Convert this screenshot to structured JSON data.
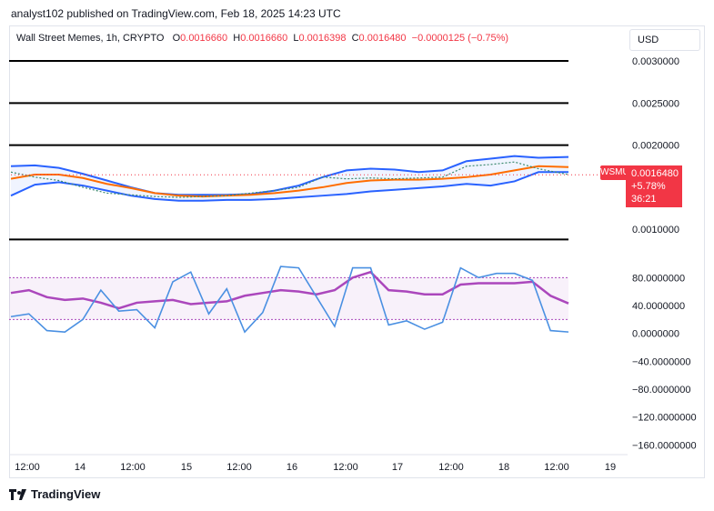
{
  "header": {
    "publish_line": "analyst102 published on TradingView.com, Feb 18, 2025 14:23 UTC"
  },
  "legend": {
    "symbol": "Wall Street Memes, 1h, CRYPTO",
    "o_label": "O",
    "o_value": "0.0016660",
    "h_label": "H",
    "h_value": "0.0016660",
    "l_label": "L",
    "l_value": "0.0016398",
    "c_label": "C",
    "c_value": "0.0016480",
    "change": "−0.0000125 (−0.75%)"
  },
  "currency_button": "USD",
  "price_tag": {
    "ticker": "WSMUSD",
    "price": "0.0016480",
    "change": "+5.78%",
    "countdown": "36:21"
  },
  "brand": {
    "name": "TradingView"
  },
  "colors": {
    "accent_red": "#f23645",
    "bb_band": "#2962ff",
    "bb_basis": "#ff6d00",
    "rsi": "#ab47bc",
    "stoch": "#4a90e2"
  },
  "chart_data": [
    {
      "type": "line",
      "title": "Wall Street Memes, 1h, CRYPTO",
      "y_ticks": [
        "0.0030000",
        "0.0025000",
        "0.0020000",
        "0.0010000"
      ],
      "ylim": [
        0.0007,
        0.0034
      ],
      "x_ticks": [
        "12:00",
        "14",
        "12:00",
        "15",
        "12:00",
        "16",
        "12:00",
        "17",
        "12:00",
        "18",
        "12:00",
        "19"
      ],
      "horizontal_levels": [
        0.003,
        0.0025,
        0.002,
        0.00088
      ],
      "series": [
        {
          "name": "bb_upper",
          "x": [
            0,
            8,
            16,
            24,
            32,
            40,
            48,
            56,
            64,
            72,
            80,
            88,
            96,
            104,
            112,
            120,
            128,
            136,
            144,
            152,
            160,
            168,
            176,
            186
          ],
          "values": [
            0.00175,
            0.00176,
            0.00173,
            0.00166,
            0.00158,
            0.0015,
            0.00143,
            0.00141,
            0.00141,
            0.00141,
            0.00142,
            0.00146,
            0.00152,
            0.00162,
            0.0017,
            0.00172,
            0.00171,
            0.00168,
            0.0017,
            0.00181,
            0.00184,
            0.00187,
            0.00185,
            0.00186
          ]
        },
        {
          "name": "bb_basis",
          "x": [
            0,
            8,
            16,
            24,
            32,
            40,
            48,
            56,
            64,
            72,
            80,
            88,
            96,
            104,
            112,
            120,
            128,
            136,
            144,
            152,
            160,
            168,
            176,
            186
          ],
          "values": [
            0.0016,
            0.00165,
            0.00165,
            0.00161,
            0.00154,
            0.00149,
            0.00143,
            0.0014,
            0.00139,
            0.0014,
            0.00141,
            0.00143,
            0.00146,
            0.0015,
            0.00155,
            0.00158,
            0.00159,
            0.00159,
            0.0016,
            0.00162,
            0.00165,
            0.0017,
            0.00175,
            0.00174
          ]
        },
        {
          "name": "bb_lower",
          "x": [
            0,
            8,
            16,
            24,
            32,
            40,
            48,
            56,
            64,
            72,
            80,
            88,
            96,
            104,
            112,
            120,
            128,
            136,
            144,
            152,
            160,
            168,
            176,
            186
          ],
          "values": [
            0.0014,
            0.00153,
            0.00156,
            0.00152,
            0.00146,
            0.0014,
            0.00136,
            0.00134,
            0.00134,
            0.00135,
            0.00135,
            0.00136,
            0.00138,
            0.0014,
            0.00142,
            0.00145,
            0.00147,
            0.00149,
            0.00151,
            0.00154,
            0.00152,
            0.00157,
            0.00168,
            0.00168
          ]
        },
        {
          "name": "price",
          "x": [
            0,
            8,
            16,
            24,
            32,
            40,
            48,
            56,
            64,
            72,
            80,
            88,
            96,
            104,
            112,
            120,
            128,
            136,
            144,
            152,
            160,
            168,
            176,
            186
          ],
          "values": [
            0.00168,
            0.00162,
            0.00158,
            0.0015,
            0.00143,
            0.00141,
            0.00139,
            0.00138,
            0.00139,
            0.0014,
            0.00143,
            0.00146,
            0.0015,
            0.00162,
            0.0016,
            0.00161,
            0.0016,
            0.00161,
            0.00162,
            0.00175,
            0.00177,
            0.0018,
            0.00172,
            0.00165
          ]
        }
      ]
    },
    {
      "type": "line",
      "y_ticks": [
        "80.0000000",
        "40.0000000",
        "0.0000000",
        "−40.0000000",
        "−80.0000000",
        "−120.0000000",
        "−160.0000000"
      ],
      "ylim": [
        -170,
        100
      ],
      "band": [
        20,
        80
      ],
      "series": [
        {
          "name": "rsi",
          "x": [
            0,
            6,
            12,
            18,
            24,
            30,
            36,
            42,
            48,
            54,
            60,
            66,
            72,
            78,
            84,
            90,
            96,
            102,
            108,
            114,
            120,
            126,
            132,
            138,
            144,
            150,
            156,
            162,
            168,
            174,
            180,
            186
          ],
          "values": [
            58,
            62,
            52,
            48,
            50,
            44,
            36,
            44,
            46,
            48,
            42,
            44,
            46,
            54,
            58,
            62,
            60,
            56,
            62,
            80,
            88,
            62,
            60,
            56,
            56,
            70,
            72,
            72,
            72,
            74,
            54,
            43
          ]
        },
        {
          "name": "stochastic_k",
          "x": [
            0,
            6,
            12,
            18,
            24,
            30,
            36,
            42,
            48,
            54,
            60,
            66,
            72,
            78,
            84,
            90,
            96,
            102,
            108,
            114,
            120,
            126,
            132,
            138,
            144,
            150,
            156,
            162,
            168,
            174,
            180,
            186
          ],
          "values": [
            24,
            28,
            4,
            2,
            20,
            62,
            32,
            34,
            8,
            74,
            88,
            28,
            64,
            2,
            30,
            96,
            94,
            52,
            10,
            94,
            94,
            12,
            18,
            6,
            16,
            94,
            80,
            86,
            86,
            76,
            4,
            2
          ]
        }
      ]
    }
  ]
}
